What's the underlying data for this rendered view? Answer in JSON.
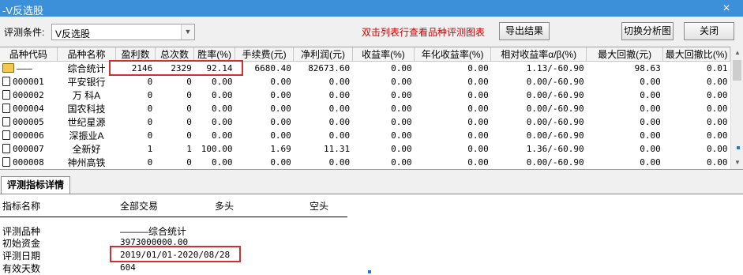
{
  "window": {
    "title": "-V反选股",
    "close_icon": "×"
  },
  "toolbar": {
    "condition_label": "评测条件:",
    "condition_value": "V反选股",
    "hint": "双击列表行查看品种评测图表",
    "export_label": "导出结果",
    "switch_label": "切换分析图",
    "close_label": "关闭"
  },
  "grid": {
    "columns": [
      "品种代码",
      "品种名称",
      "盈利数",
      "总次数",
      "胜率(%)",
      "手续费(元)",
      "净利润(元)",
      "收益率(%)",
      "年化收益率(%)",
      "相对收益率α/β(%)",
      "最大回撤(元)",
      "最大回撤比(%)"
    ],
    "rows": [
      {
        "icon": "folder-icon",
        "code": "———",
        "name": "综合统计",
        "wins": "2146",
        "total": "2329",
        "win_rate": "92.14",
        "fee": "6680.40",
        "net": "82673.60",
        "ret": "0.00",
        "annual": "0.00",
        "relative": "1.13/-60.90",
        "drawdown": "98.63",
        "drawdown_ratio": "0.01"
      },
      {
        "icon": "document-icon",
        "code": "000001",
        "name": "平安银行",
        "wins": "0",
        "total": "0",
        "win_rate": "0.00",
        "fee": "0.00",
        "net": "0.00",
        "ret": "0.00",
        "annual": "0.00",
        "relative": "0.00/-60.90",
        "drawdown": "0.00",
        "drawdown_ratio": "0.00"
      },
      {
        "icon": "document-icon",
        "code": "000002",
        "name": "万 科A",
        "wins": "0",
        "total": "0",
        "win_rate": "0.00",
        "fee": "0.00",
        "net": "0.00",
        "ret": "0.00",
        "annual": "0.00",
        "relative": "0.00/-60.90",
        "drawdown": "0.00",
        "drawdown_ratio": "0.00"
      },
      {
        "icon": "document-icon",
        "code": "000004",
        "name": "国农科技",
        "wins": "0",
        "total": "0",
        "win_rate": "0.00",
        "fee": "0.00",
        "net": "0.00",
        "ret": "0.00",
        "annual": "0.00",
        "relative": "0.00/-60.90",
        "drawdown": "0.00",
        "drawdown_ratio": "0.00"
      },
      {
        "icon": "document-icon",
        "code": "000005",
        "name": "世纪星源",
        "wins": "0",
        "total": "0",
        "win_rate": "0.00",
        "fee": "0.00",
        "net": "0.00",
        "ret": "0.00",
        "annual": "0.00",
        "relative": "0.00/-60.90",
        "drawdown": "0.00",
        "drawdown_ratio": "0.00"
      },
      {
        "icon": "document-icon",
        "code": "000006",
        "name": "深振业A",
        "wins": "0",
        "total": "0",
        "win_rate": "0.00",
        "fee": "0.00",
        "net": "0.00",
        "ret": "0.00",
        "annual": "0.00",
        "relative": "0.00/-60.90",
        "drawdown": "0.00",
        "drawdown_ratio": "0.00"
      },
      {
        "icon": "document-icon",
        "code": "000007",
        "name": "全新好",
        "wins": "1",
        "total": "1",
        "win_rate": "100.00",
        "fee": "1.69",
        "net": "11.31",
        "ret": "0.00",
        "annual": "0.00",
        "relative": "1.36/-60.90",
        "drawdown": "0.00",
        "drawdown_ratio": "0.00"
      },
      {
        "icon": "document-icon",
        "code": "000008",
        "name": "神州高铁",
        "wins": "0",
        "total": "0",
        "win_rate": "0.00",
        "fee": "0.00",
        "net": "0.00",
        "ret": "0.00",
        "annual": "0.00",
        "relative": "0.00/-60.90",
        "drawdown": "0.00",
        "drawdown_ratio": "0.00"
      }
    ]
  },
  "detail": {
    "tab_label": "评测指标详情",
    "headers": {
      "metric": "指标名称",
      "all": "全部交易",
      "long": "多头",
      "short": "空头"
    },
    "rows": [
      {
        "label": "评测品种",
        "value": "———综合统计"
      },
      {
        "label": "初始资金",
        "value": "3973000000.00"
      },
      {
        "label": "评测日期",
        "value": "2019/01/01-2020/08/28"
      },
      {
        "label": "有效天数",
        "value": "604"
      }
    ]
  },
  "colors": {
    "titlebar": "#3c8fd9",
    "hint": "#cc0000",
    "highlight": "#d0302f"
  }
}
